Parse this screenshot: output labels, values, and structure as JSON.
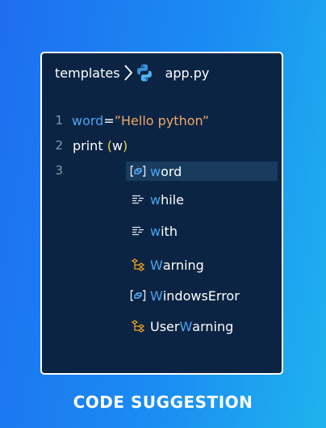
{
  "breadcrumb": {
    "folder": "templates",
    "file": "app.py"
  },
  "editor": {
    "lines": [
      {
        "number": "1",
        "var": "word",
        "op": "=",
        "str": "”Hello python”"
      },
      {
        "number": "2",
        "fn": "print ",
        "paren_open": "(",
        "arg": "w",
        "paren_close": ")"
      },
      {
        "number": "3"
      }
    ]
  },
  "suggestions": [
    {
      "kind": "variable",
      "match": "w",
      "rest": "ord",
      "icon": "variable-icon"
    },
    {
      "kind": "keyword",
      "match": "w",
      "rest": "hile",
      "icon": "keyword-icon"
    },
    {
      "kind": "keyword",
      "match": "w",
      "rest": "ith",
      "icon": "keyword-icon"
    },
    {
      "kind": "class",
      "match": "W",
      "rest": "arning",
      "icon": "class-icon"
    },
    {
      "kind": "variable",
      "match": "W",
      "rest": "indowsError",
      "icon": "variable-icon"
    },
    {
      "kind": "class",
      "prefix": "User",
      "match": "W",
      "rest": "arning",
      "icon": "class-icon"
    }
  ],
  "caption": "CODE SUGGESTION",
  "colors": {
    "background_start": "#1e6ef0",
    "background_end": "#1fb2ee",
    "editor_bg": "#0b2443",
    "variable": "#4ea3f0",
    "string": "#f0a86a",
    "paren": "#f1d34a",
    "class_icon": "#f0a020",
    "selection": "#183b5e"
  }
}
